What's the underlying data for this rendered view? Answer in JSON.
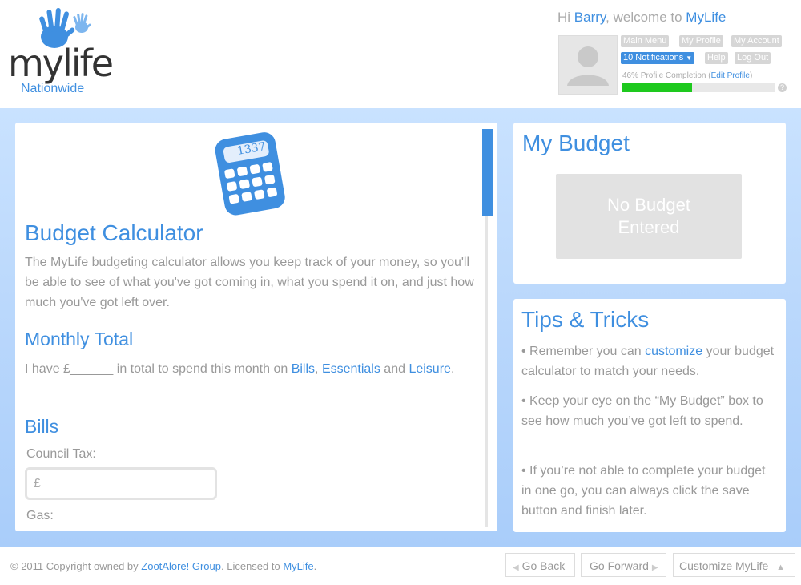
{
  "header": {
    "logo_text": "mylife",
    "logo_sub": "Nationwide",
    "welcome_prefix": "Hi ",
    "user_name": "Barry",
    "welcome_middle": ", welcome to ",
    "app_name": "MyLife",
    "buttons": {
      "main_menu": "Main Menu",
      "my_profile": "My Profile",
      "my_account": "My Account",
      "notifications": "10 Notifications",
      "help": "Help",
      "log_out": "Log Out"
    },
    "completion_text": "46% Profile Completion (",
    "edit_profile": "Edit Profile",
    "completion_close": ")",
    "profile_completion_percent": 46,
    "help_icon": "?"
  },
  "calculator": {
    "icon_display": "1337",
    "title": "Budget Calculator",
    "intro": "The MyLife budgeting calculator allows you keep track of your money, so you'll be able to see of what you've got coming in, what you spend it on, and just how much you've got left over.",
    "monthly_title": "Monthly Total",
    "monthly_prefix": "I have £______ in total to spend this month on ",
    "link_bills": "Bills",
    "comma": ",",
    "link_essentials": "Essentials",
    "and": " and ",
    "link_leisure": "Leisure",
    "period": ".",
    "bills_title": "Bills",
    "council_tax_label": "Council Tax:",
    "council_tax_value": "£",
    "gas_label": "Gas:"
  },
  "budget": {
    "title": "My Budget",
    "empty_line1": "No Budget",
    "empty_line2": "Entered"
  },
  "tips": {
    "title": "Tips & Tricks",
    "tip1_prefix": "• Remember you can ",
    "tip1_link": "customize",
    "tip1_suffix": " your budget calculator to match your needs.",
    "tip2": "• Keep your eye on the “My Budget” box to see how much you’ve got left to spend.",
    "tip3": "• If you’re not able to complete your budget in one go, you can always click the save button and finish later."
  },
  "footer": {
    "copyright_prefix": "© 2011 Copyright owned by ",
    "owner": "ZootAlore! Group",
    "licensed": ". Licensed to ",
    "licensee": "MyLife",
    "end": ".",
    "go_back": "Go Back",
    "go_forward": "Go Forward",
    "customize": "Customize MyLife"
  },
  "colors": {
    "accent": "#3f8fe0",
    "progress": "#1ec91e",
    "background_blue": "#bcd9fc"
  }
}
